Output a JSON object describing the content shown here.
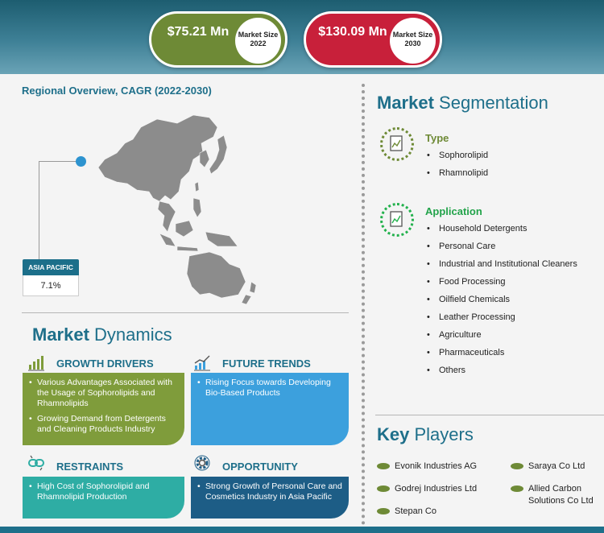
{
  "market_size": [
    {
      "value": "$75.21 Mn",
      "label_line1": "Market Size",
      "label_line2": "2022",
      "color": "#6e8a36"
    },
    {
      "value": "$130.09 Mn",
      "label_line1": "Market Size",
      "label_line2": "2030",
      "color": "#c8203a"
    }
  ],
  "regional": {
    "title": "Regional Overview, CAGR (2022-2030)",
    "region": "ASIA PACIFIC",
    "cagr": "7.1%"
  },
  "dynamics": {
    "title_a": "Market",
    "title_b": "Dynamics",
    "growth_drivers": {
      "heading": "GROWTH DRIVERS",
      "icon": "bar-chart-icon",
      "color": "#7f9c3b",
      "items": [
        "Various Advantages Associated with the Usage of Sophorolipids and Rhamnolipids",
        "Growing Demand from Detergents and Cleaning Products Industry"
      ]
    },
    "future_trends": {
      "heading": "FUTURE TRENDS",
      "icon": "trend-chart-icon",
      "color": "#3ca0dd",
      "items": [
        "Rising Focus towards Developing Bio-Based Products"
      ]
    },
    "restraints": {
      "heading": "RESTRAINTS",
      "icon": "chain-link-icon",
      "color": "#2eada4",
      "items": [
        "High Cost of Sophorolipid and Rhamnolipid Production"
      ]
    },
    "opportunity": {
      "heading": "OPPORTUNITY",
      "icon": "gear-icon",
      "color": "#1d5d86",
      "items": [
        "Strong Growth of Personal Care and Cosmetics Industry in Asia Pacific"
      ]
    }
  },
  "segmentation": {
    "title_a": "Market",
    "title_b": "Segmentation",
    "type": {
      "heading": "Type",
      "items": [
        "Sophorolipid",
        "Rhamnolipid"
      ]
    },
    "application": {
      "heading": "Application",
      "items": [
        "Household Detergents",
        "Personal Care",
        "Industrial and Institutional Cleaners",
        "Food Processing",
        "Oilfield Chemicals",
        "Leather Processing",
        "Agriculture",
        "Pharmaceuticals",
        "Others"
      ]
    }
  },
  "key_players": {
    "title_a": "Key",
    "title_b": "Players",
    "items": [
      "Evonik Industries AG",
      "Saraya Co Ltd",
      "Godrej Industries Ltd",
      "Allied Carbon Solutions Co Ltd",
      "Stepan Co"
    ]
  }
}
